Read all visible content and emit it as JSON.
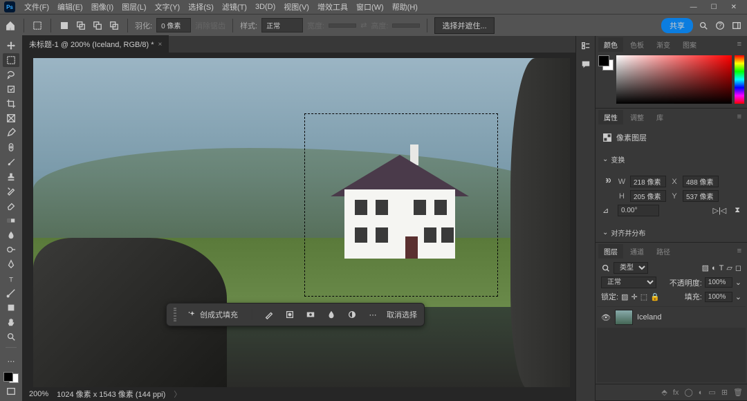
{
  "window": {
    "min": "—",
    "max": "☐",
    "close": "✕"
  },
  "menu": {
    "items": [
      "文件(F)",
      "编辑(E)",
      "图像(I)",
      "图层(L)",
      "文字(Y)",
      "选择(S)",
      "滤镜(T)",
      "3D(D)",
      "视图(V)",
      "增效工具",
      "窗口(W)",
      "帮助(H)"
    ]
  },
  "optbar": {
    "feather_label": "羽化:",
    "feather_value": "0 像素",
    "antialias": "消除锯齿",
    "style_label": "样式:",
    "style_value": "正常",
    "width_label": "宽度:",
    "height_label": "高度:",
    "select_mask": "选择并遮住...",
    "share": "共享"
  },
  "tab": {
    "title": "未标题-1 @ 200% (Iceland, RGB/8) *"
  },
  "context": {
    "generative": "创成式填充",
    "cancel": "取消选择"
  },
  "status": {
    "zoom": "200%",
    "dims": "1024 像素 x 1543 像素 (144 ppi)"
  },
  "panels": {
    "color_tabs": [
      "颜色",
      "色板",
      "渐变",
      "图案"
    ],
    "props_tabs": [
      "属性",
      "调整",
      "库"
    ],
    "layer_tabs": [
      "图层",
      "通道",
      "路径"
    ],
    "pixel_layer": "像素图层",
    "transform": "变换",
    "align": "对齐并分布",
    "w": "218 像素",
    "h": "205 像素",
    "x": "488 像素",
    "y": "537 像素",
    "angle": "0.00°",
    "kind": "类型",
    "blend": "正常",
    "opacity_l": "不透明度:",
    "opacity_v": "100%",
    "lock": "锁定:",
    "fill_l": "填充:",
    "fill_v": "100%",
    "layer_name": "Iceland",
    "W": "W",
    "H": "H",
    "X": "X",
    "Y": "Y"
  }
}
